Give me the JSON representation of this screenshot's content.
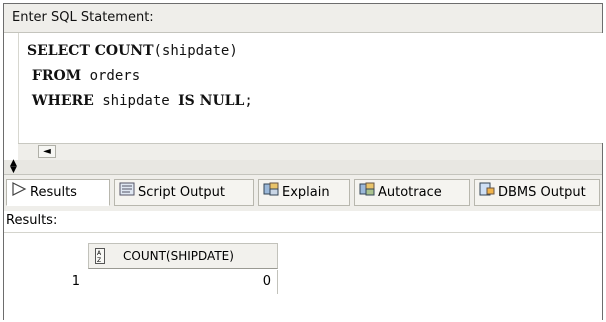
{
  "editor": {
    "title": "Enter SQL Statement:",
    "lines": [
      [
        {
          "t": "SELECT COUNT",
          "kw": true
        },
        {
          "t": "(shipdate)",
          "kw": false
        }
      ],
      [
        {
          "t": " FROM",
          "kw": true
        },
        {
          "t": " orders",
          "kw": false
        }
      ],
      [
        {
          "t": " WHERE",
          "kw": true
        },
        {
          "t": " shipdate ",
          "kw": false
        },
        {
          "t": "IS NULL",
          "kw": true
        },
        {
          "t": ";",
          "kw": false
        }
      ]
    ]
  },
  "scroll": {
    "left_arrow": "◄"
  },
  "splitter": {
    "up": "▲",
    "down": "▼"
  },
  "tabs": [
    {
      "label": "Results",
      "icon": "play-triangle-icon",
      "active": true
    },
    {
      "label": "Script Output",
      "icon": "script-output-icon",
      "active": false
    },
    {
      "label": "Explain",
      "icon": "explain-plan-icon",
      "active": false
    },
    {
      "label": "Autotrace",
      "icon": "autotrace-icon",
      "active": false
    },
    {
      "label": "DBMS Output",
      "icon": "dbms-output-icon",
      "active": false
    }
  ],
  "results": {
    "label": "Results:",
    "columns": [
      {
        "label": "COUNT(SHIPDATE)",
        "icon": "sort-az-icon"
      }
    ],
    "rows": [
      {
        "num": "1",
        "values": [
          "0"
        ]
      }
    ]
  }
}
